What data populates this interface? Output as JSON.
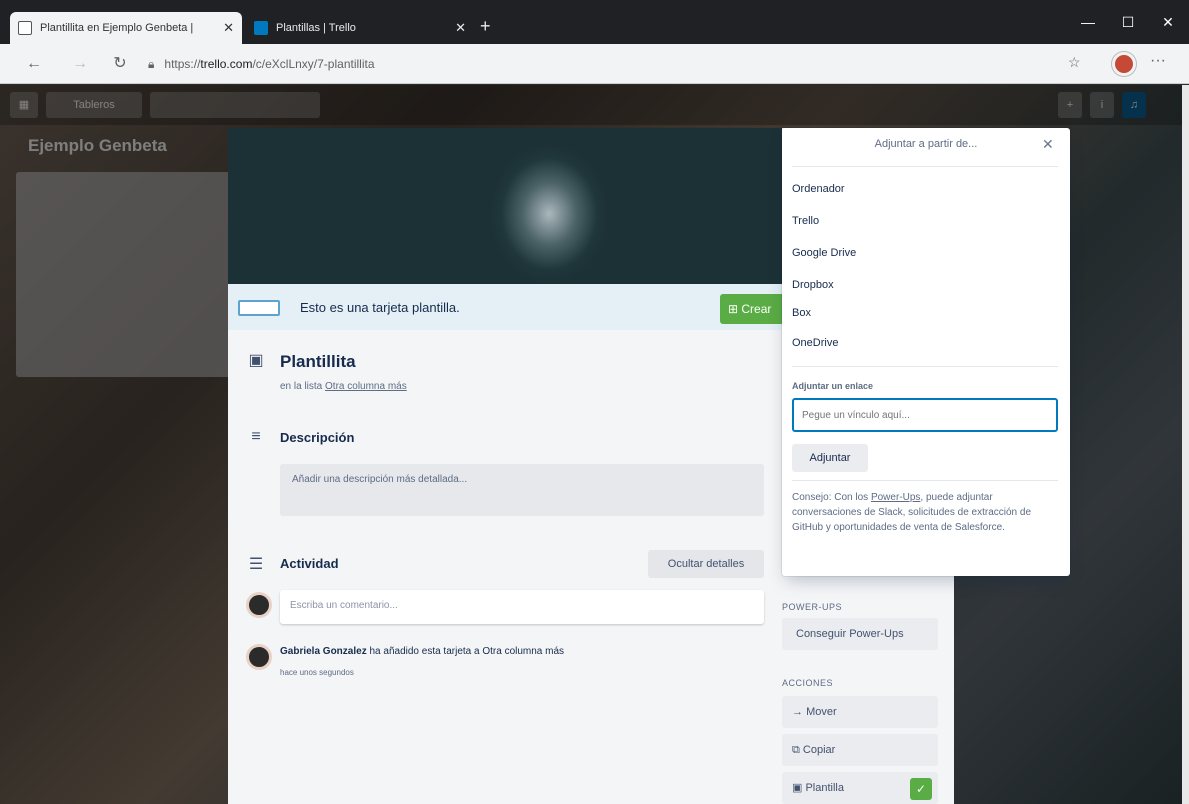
{
  "browser": {
    "tabs": [
      {
        "title": "Plantillita en Ejemplo Genbeta |",
        "active": true
      },
      {
        "title": "Plantillas | Trello",
        "active": false
      }
    ],
    "new_tab": "+",
    "url_domain": "trello.com",
    "url_prefix": "https://",
    "url_path": "/c/eXclLnxy/7-plantillita",
    "win_controls": [
      "—",
      "☐",
      "✕"
    ]
  },
  "trello": {
    "tableros_label": "Tableros",
    "board_title": "Ejemplo Genbeta"
  },
  "banner": {
    "text": "Esto es una tarjeta plantilla.",
    "create_label": "Crear"
  },
  "card": {
    "title": "Plantillita",
    "list_prefix": "en la lista",
    "list_name": "Otra columna más",
    "description_heading": "Descripción",
    "description_placeholder": "Añadir una descripción más detallada...",
    "activity_heading": "Actividad",
    "hide_details": "Ocultar detalles",
    "comment_placeholder": "Escriba un comentario...",
    "activity_user": "Gabriela Gonzalez",
    "activity_text": "ha añadido esta tarjeta a Otra columna más",
    "activity_time": "hace unos segundos"
  },
  "sidebar": {
    "powerups_label": "POWER-UPS",
    "powerups_button": "Conseguir Power-Ups",
    "actions_label": "ACCIONES",
    "move": "Mover",
    "copy": "Copiar",
    "template": "Plantilla"
  },
  "popover": {
    "title": "Adjuntar a partir de...",
    "sources": [
      "Ordenador",
      "Trello",
      "Google Drive",
      "Dropbox",
      "Box",
      "OneDrive"
    ],
    "link_label": "Adjuntar un enlace",
    "link_placeholder": "Pegue un vínculo aquí...",
    "attach_button": "Adjuntar",
    "tip_prefix": "Consejo: Con los",
    "tip_link": "Power-Ups",
    "tip_suffix": ", puede adjuntar conversaciones de Slack, solicitudes de extracción de GitHub y oportunidades de venta de Salesforce."
  },
  "colors": {
    "accent": "#0079bf",
    "green": "#5aac44"
  }
}
